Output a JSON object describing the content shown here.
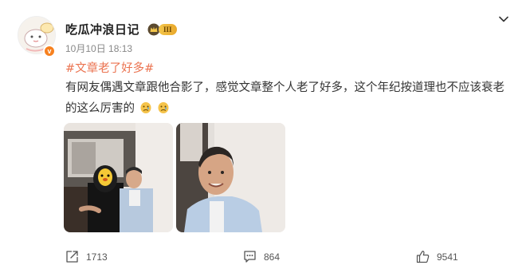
{
  "post": {
    "author": "吃瓜冲浪日记",
    "level_label": "III",
    "verified_mark": "v",
    "timestamp": "10月10日 18:13",
    "hashtag": "#文章老了好多#",
    "text": "有网友偶遇文章跟他合影了，感觉文章整个人老了好多，这个年纪按道理也不应该衰老的这么厉害的",
    "images": [
      "photo-1",
      "photo-2"
    ]
  },
  "actions": {
    "repost_count": "1713",
    "comment_count": "864",
    "like_count": "9541"
  },
  "icons": {
    "more": "chevron-down-icon",
    "repost": "share-icon",
    "comment": "comment-icon",
    "like": "thumb-up-icon",
    "emoji": "sad-face-emoji"
  },
  "colors": {
    "hashtag": "#eb7350",
    "verified": "#f7811f",
    "level_badge": "#f3c64b"
  }
}
